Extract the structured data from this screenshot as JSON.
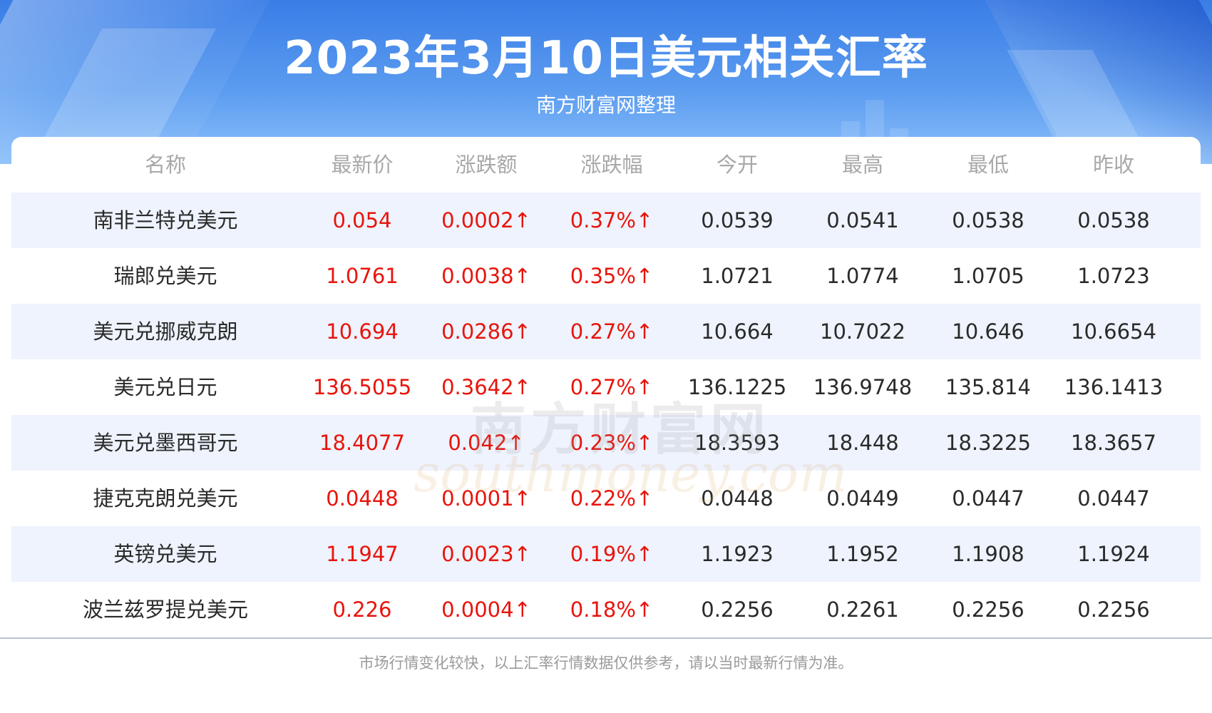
{
  "header": {
    "title": "2023年3月10日美元相关汇率",
    "subtitle": "南方财富网整理"
  },
  "table": {
    "columns": [
      "名称",
      "最新价",
      "涨跌额",
      "涨跌幅",
      "今开",
      "最高",
      "最低",
      "昨收"
    ],
    "rows": [
      [
        "南非兰特兑美元",
        "0.054",
        "0.0002↑",
        "0.37%↑",
        "0.0539",
        "0.0541",
        "0.0538",
        "0.0538"
      ],
      [
        "瑞郎兑美元",
        "1.0761",
        "0.0038↑",
        "0.35%↑",
        "1.0721",
        "1.0774",
        "1.0705",
        "1.0723"
      ],
      [
        "美元兑挪威克朗",
        "10.694",
        "0.0286↑",
        "0.27%↑",
        "10.664",
        "10.7022",
        "10.646",
        "10.6654"
      ],
      [
        "美元兑日元",
        "136.5055",
        "0.3642↑",
        "0.27%↑",
        "136.1225",
        "136.9748",
        "135.814",
        "136.1413"
      ],
      [
        "美元兑墨西哥元",
        "18.4077",
        "0.042↑",
        "0.23%↑",
        "18.3593",
        "18.448",
        "18.3225",
        "18.3657"
      ],
      [
        "捷克克朗兑美元",
        "0.0448",
        "0.0001↑",
        "0.22%↑",
        "0.0448",
        "0.0449",
        "0.0447",
        "0.0447"
      ],
      [
        "英镑兑美元",
        "1.1947",
        "0.0023↑",
        "0.19%↑",
        "1.1923",
        "1.1952",
        "1.1908",
        "1.1924"
      ],
      [
        "波兰兹罗提兑美元",
        "0.226",
        "0.0004↑",
        "0.18%↑",
        "0.2256",
        "0.2261",
        "0.2256",
        "0.2256"
      ]
    ]
  },
  "watermark": {
    "cn": "南方财富网",
    "en": "southmoney.com"
  },
  "footer": {
    "note": "市场行情变化较快，以上汇率行情数据仅供参考，请以当时最新行情为准。"
  },
  "colors": {
    "up": "#e8140c",
    "banner": "#3a7de6",
    "stripe": "#eef3fd"
  }
}
